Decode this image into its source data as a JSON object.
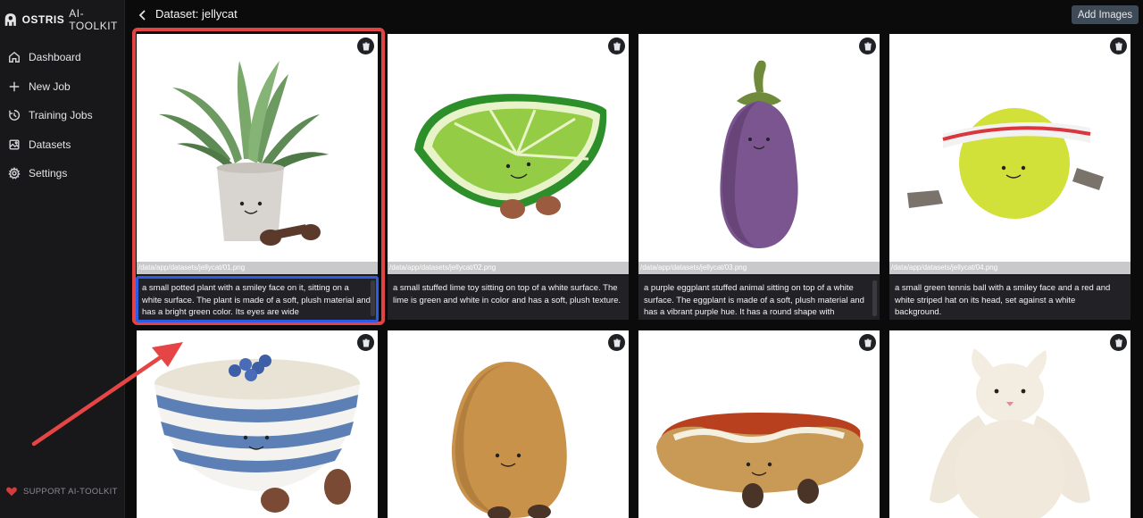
{
  "brand": {
    "name_bold": "OSTRIS",
    "name_light": "AI-TOOLKIT"
  },
  "nav": [
    {
      "label": "Dashboard",
      "icon": "home-icon"
    },
    {
      "label": "New Job",
      "icon": "plus-icon"
    },
    {
      "label": "Training Jobs",
      "icon": "training-icon"
    },
    {
      "label": "Datasets",
      "icon": "images-icon"
    },
    {
      "label": "Settings",
      "icon": "gear-icon"
    }
  ],
  "support_label": "SUPPORT AI-TOOLKIT",
  "header": {
    "title": "Dataset: jellycat",
    "add_button": "Add Images"
  },
  "colors": {
    "accent_red": "#e24444",
    "accent_blue": "#2d5be3",
    "button_bg": "#3f4a57"
  },
  "images": [
    {
      "path": "/data/app/datasets/jellycat/01.png",
      "caption": "a small potted plant with a smiley face on it, sitting on a white surface. The plant is made of a soft, plush material and has a bright green color. Its eyes are wide",
      "subject": "plant"
    },
    {
      "path": "/data/app/datasets/jellycat/02.png",
      "caption": "a small stuffed lime toy sitting on top of a white surface. The lime is green and white in color and has a soft, plush texture.",
      "subject": "lime"
    },
    {
      "path": "/data/app/datasets/jellycat/03.png",
      "caption": "a purple eggplant stuffed animal sitting on top of a white surface. The eggplant is made of a soft, plush material and has a vibrant purple hue. It has a round shape with",
      "subject": "eggplant"
    },
    {
      "path": "/data/app/datasets/jellycat/04.png",
      "caption": "a small green tennis ball with a smiley face and a red and white striped hat on its head, set against a white background.",
      "subject": "tennis-ball"
    },
    {
      "path": "",
      "caption": "",
      "subject": "bowl"
    },
    {
      "path": "",
      "caption": "",
      "subject": "potato"
    },
    {
      "path": "",
      "caption": "",
      "subject": "hotdog"
    },
    {
      "path": "",
      "caption": "",
      "subject": "bunny"
    }
  ]
}
